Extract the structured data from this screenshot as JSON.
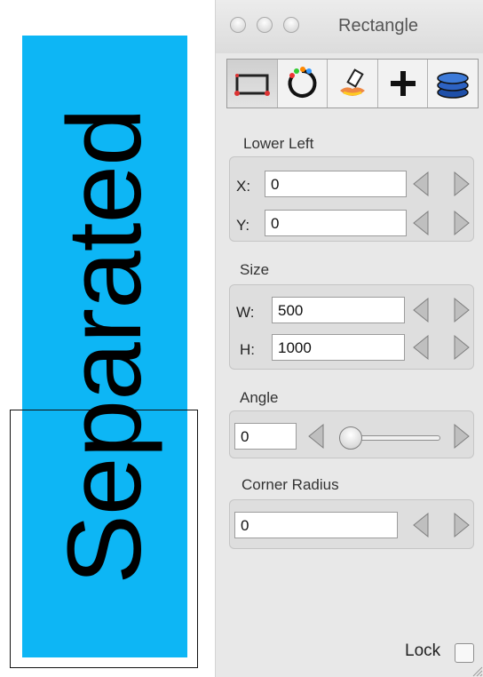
{
  "canvas": {
    "rotated_text": "Separated",
    "fill_color": "#0db6f5",
    "outline_color": "#111111"
  },
  "window": {
    "title": "Rectangle",
    "traffic_lights": [
      "close-icon",
      "minimize-icon",
      "zoom-icon"
    ]
  },
  "toolbar": {
    "tools": [
      "rectangle-geometry-icon",
      "color-wheel-icon",
      "paint-bucket-icon",
      "crosshair-plus-icon",
      "layers-stack-icon"
    ],
    "selected": "rectangle-geometry-icon"
  },
  "lower_left": {
    "label": "Lower Left",
    "x_label": "X:",
    "x_value": "0",
    "y_label": "Y:",
    "y_value": "0"
  },
  "size": {
    "label": "Size",
    "w_label": "W:",
    "w_value": "500",
    "h_label": "H:",
    "h_value": "1000"
  },
  "angle": {
    "label": "Angle",
    "value": "0",
    "slider_fraction": 0.0
  },
  "corner_radius": {
    "label": "Corner Radius",
    "value": "0"
  },
  "lock": {
    "label": "Lock",
    "checked": false
  }
}
